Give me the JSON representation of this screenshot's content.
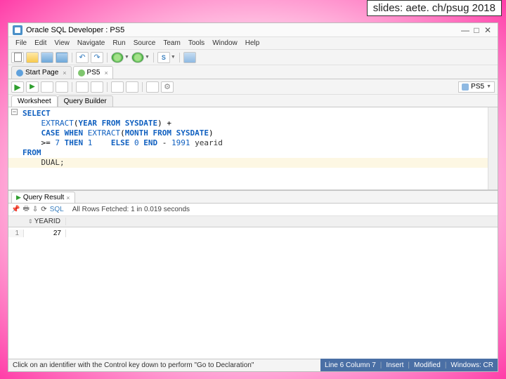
{
  "slide_banner": "slides: aete. ch/psug 2018",
  "window": {
    "title": "Oracle SQL Developer : PS5"
  },
  "menu": {
    "file": "File",
    "edit": "Edit",
    "view": "View",
    "navigate": "Navigate",
    "run": "Run",
    "source": "Source",
    "team": "Team",
    "tools": "Tools",
    "window": "Window",
    "help": "Help"
  },
  "doctabs": {
    "start": "Start Page",
    "active": "PS5"
  },
  "connection": {
    "name": "PS5"
  },
  "inner_tabs": {
    "worksheet": "Worksheet",
    "query_builder": "Query Builder"
  },
  "sql": {
    "l1a": "SELECT",
    "l2a": "    EXTRACT",
    "l2b": "(",
    "l2c": "YEAR",
    "l2d": " FROM ",
    "l2e": "SYSDATE",
    "l2f": ") +",
    "l3a": "    CASE WHEN ",
    "l3b": "EXTRACT",
    "l3c": "(",
    "l3d": "MONTH",
    "l3e": " FROM ",
    "l3f": "SYSDATE",
    "l3g": ")",
    "l4a": "    >= ",
    "l4b": "7",
    "l4c": " THEN ",
    "l4d": "1",
    "l4e": "    ELSE ",
    "l4f": "0",
    "l4g": " END",
    "l4h": " - ",
    "l4i": "1991",
    "l4j": " yearid",
    "l5a": "FROM",
    "l6a": "    DUAL;"
  },
  "result": {
    "tab": "Query Result",
    "sql_label": "SQL",
    "status": "All Rows Fetched: 1 in 0.019 seconds",
    "col1": "YEARID",
    "row1_num": "1",
    "row1_val": "27"
  },
  "status": {
    "hint": "Click on an identifier with the Control key down to perform \"Go to Declaration\"",
    "linecol": "Line 6 Column 7",
    "insert": "Insert",
    "modified": "Modified",
    "plat": "Windows: CR"
  }
}
